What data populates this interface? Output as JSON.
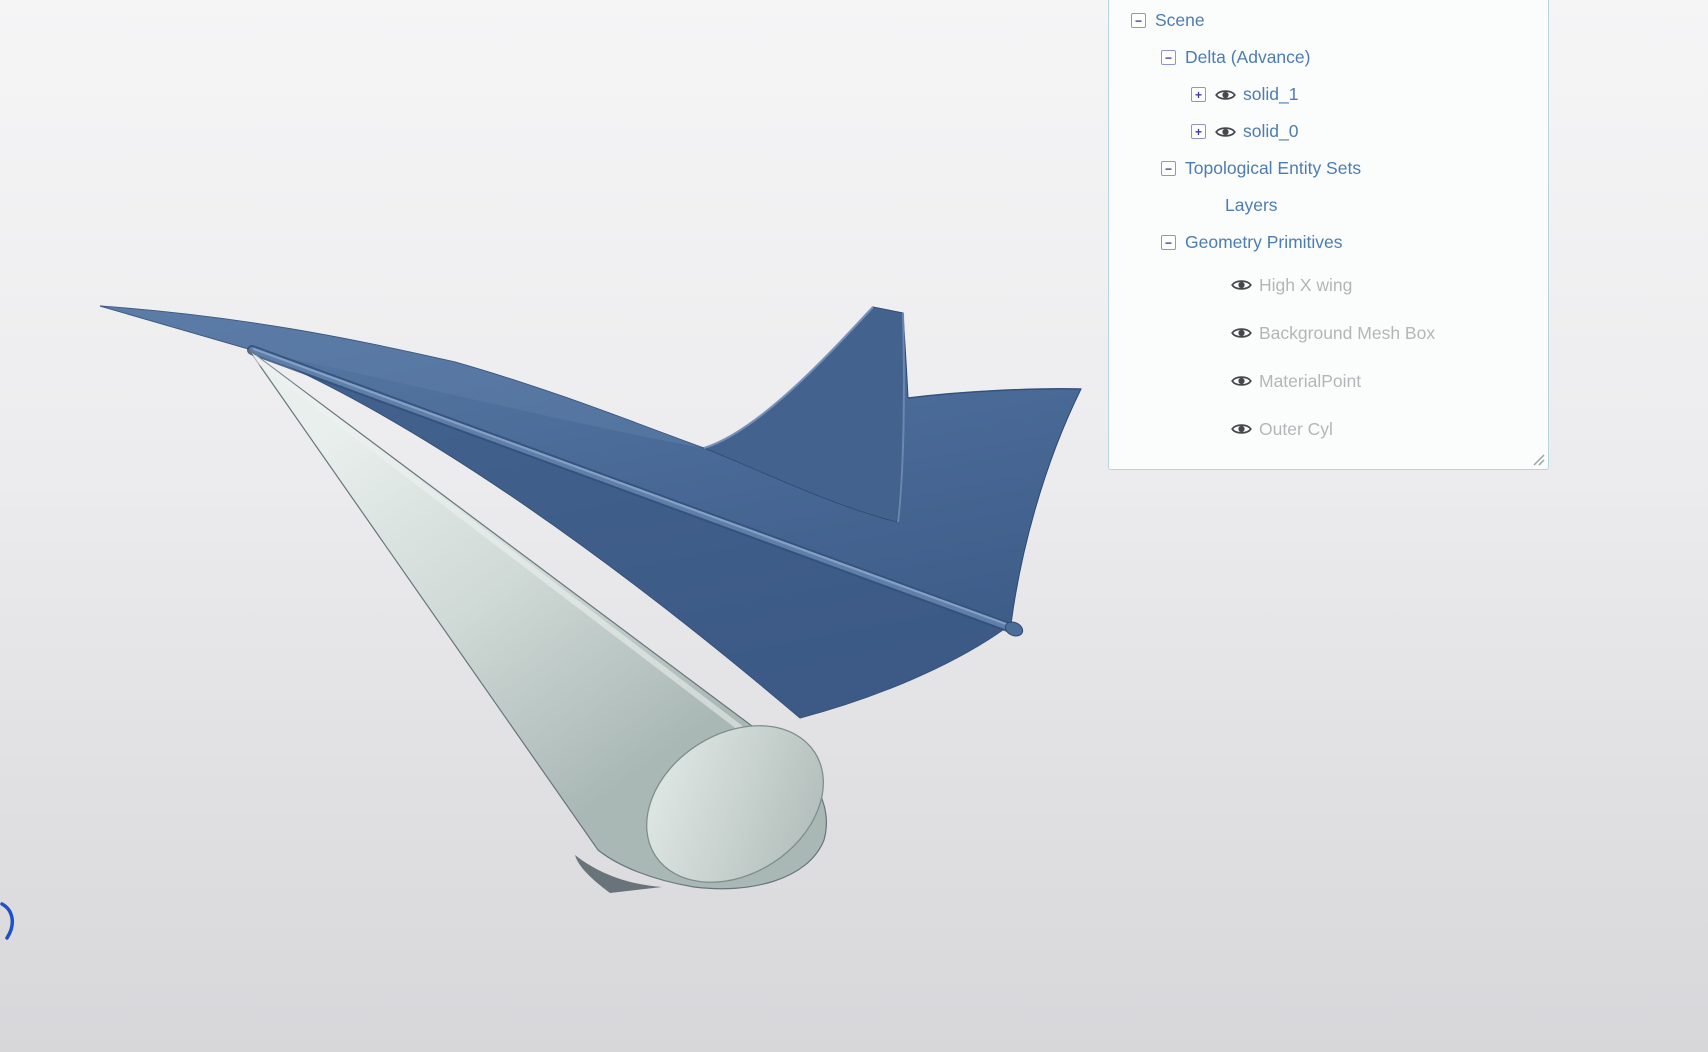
{
  "scene_tree": {
    "items": [
      {
        "label": "Scene",
        "level": 0,
        "expander": "minus",
        "eye": false,
        "state": "link"
      },
      {
        "label": "Delta (Advance)",
        "level": 1,
        "expander": "minus",
        "eye": false,
        "state": "link"
      },
      {
        "label": "solid_1",
        "level": 2,
        "expander": "plus",
        "eye": true,
        "state": "link"
      },
      {
        "label": "solid_0",
        "level": 2,
        "expander": "plus",
        "eye": true,
        "state": "link"
      },
      {
        "label": "Topological Entity Sets",
        "level": 1,
        "expander": "minus",
        "eye": false,
        "state": "link"
      },
      {
        "label": "Layers",
        "level": 2,
        "expander": null,
        "eye": false,
        "state": "link"
      },
      {
        "label": "Geometry Primitives",
        "level": 1,
        "expander": "minus",
        "eye": false,
        "state": "link"
      },
      {
        "label": "High X wing",
        "level": 2,
        "expander": null,
        "eye": true,
        "state": "disabled"
      },
      {
        "label": "Background Mesh Box",
        "level": 2,
        "expander": null,
        "eye": true,
        "state": "disabled"
      },
      {
        "label": "MaterialPoint",
        "level": 2,
        "expander": null,
        "eye": true,
        "state": "disabled"
      },
      {
        "label": "Outer Cyl",
        "level": 2,
        "expander": null,
        "eye": true,
        "state": "disabled"
      }
    ]
  },
  "colors": {
    "link_blue": "#4d7cb2",
    "disabled_gray": "#b3b6b8",
    "panel_border": "#b5d6de",
    "wing_blue": "#4a6a97",
    "wing_dark_blue": "#3c5a85",
    "cone_gray": "#ccd6d3"
  }
}
